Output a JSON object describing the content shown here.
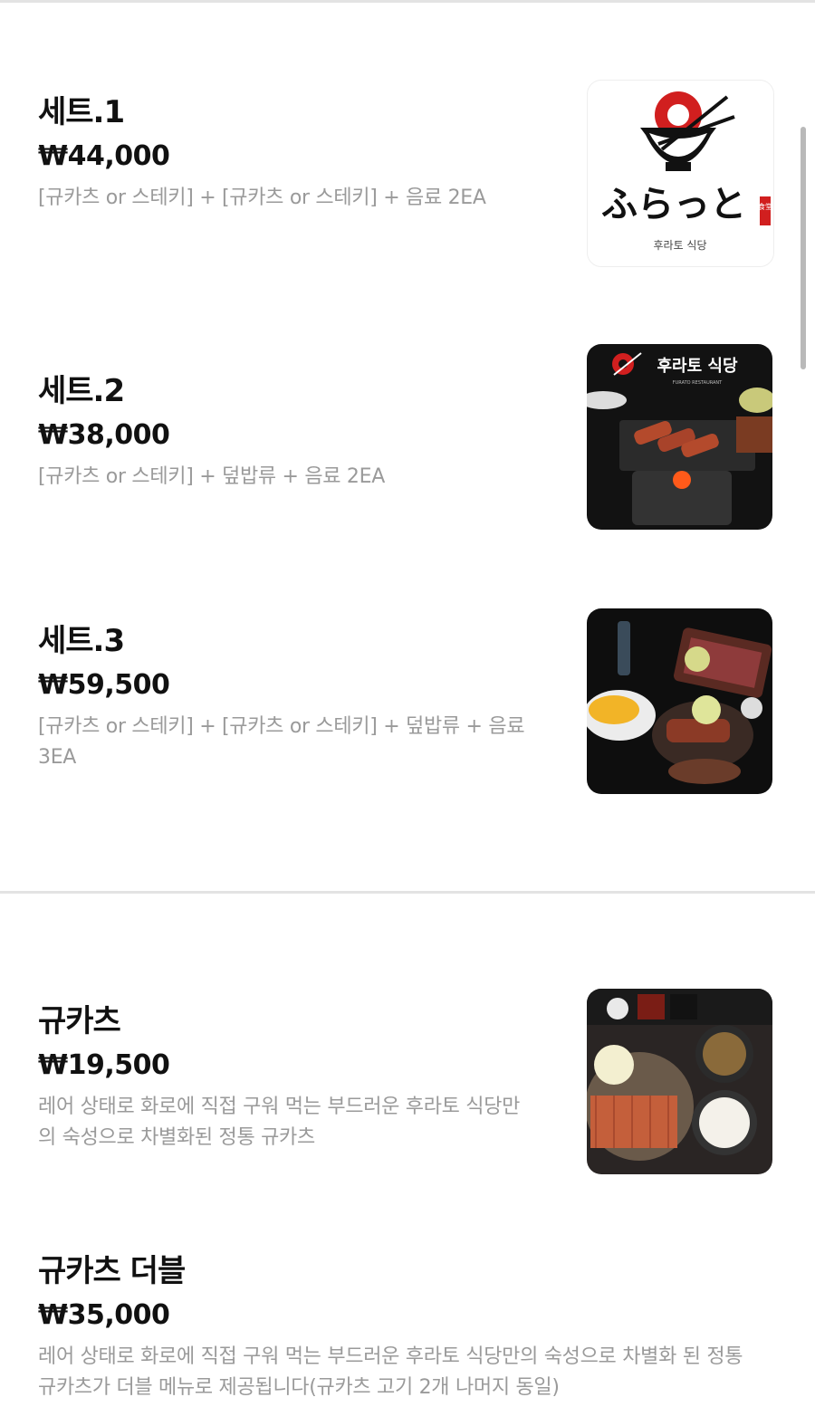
{
  "menu": {
    "items": [
      {
        "name": "세트.1",
        "price": "₩44,000",
        "desc": "[규카츠 or 스테키] + [규카츠 or 스테키] + 음료 2EA"
      },
      {
        "name": "세트.2",
        "price": "₩38,000",
        "desc": "[규카츠 or 스테키] + 덮밥류 + 음료 2EA"
      },
      {
        "name": "세트.3",
        "price": "₩59,500",
        "desc": "[규카츠 or 스테키] + [규카츠 or 스테키] + 덮밥류 + 음료 3EA"
      },
      {
        "name": "규카츠",
        "price": "₩19,500",
        "desc": "레어 상태로 화로에 직접 구워 먹는 부드러운 후라토 식당만의 숙성으로 차별화된 정통 규카츠"
      },
      {
        "name": "규카츠 더블",
        "price": "₩35,000",
        "desc": "레어 상태로 화로에 직접 구워 먹는 부드러운 후라토 식당만의 숙성으로 차별화 된 정통 규카츠가 더블 메뉴로 제공됩니다(규카츠 고기 2개 나머지 동일)"
      }
    ]
  },
  "logo": {
    "script": "ふらっと",
    "subtitle": "후라토 식당",
    "seal": "食堂"
  },
  "photo2": {
    "sign": "후라토 식당",
    "sign_small": "FURATO RESTAURANT"
  },
  "colors": {
    "accent_red": "#d11f1f",
    "desc_gray": "#9a9a9a",
    "text_dark": "#111111"
  }
}
